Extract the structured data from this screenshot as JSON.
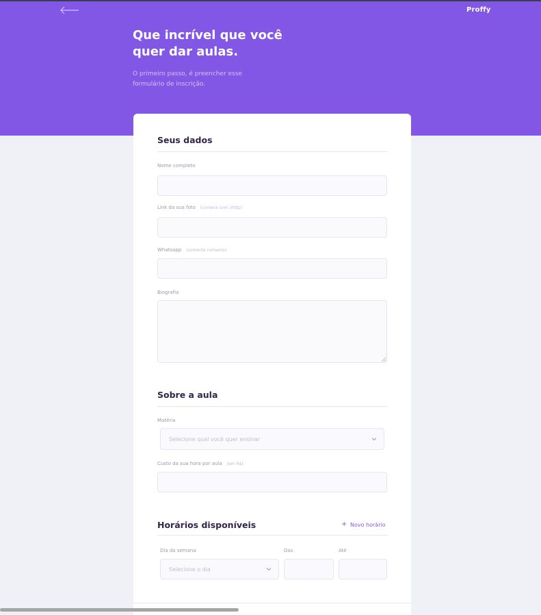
{
  "header": {
    "logo": "Proffy",
    "title": "Que incrível que você quer dar aulas.",
    "subtitle": "O primeiro passo, é preencher esse formulário de inscrição.",
    "back_icon": "arrow-left-icon"
  },
  "colors": {
    "primary": "#8257e5",
    "background": "#f0f0f7",
    "card": "#ffffff",
    "title_text": "#32264d",
    "label_text": "#9c98a6"
  },
  "sections": {
    "personal": {
      "title": "Seus dados",
      "name_label": "Nome completo",
      "avatar_label": "Link da sua foto",
      "avatar_hint": "(comece com //http)",
      "whatsapp_label": "Whatsapp",
      "whatsapp_hint": "(somente números)",
      "bio_label": "Biografia"
    },
    "class": {
      "title": "Sobre a aula",
      "subject_label": "Matéria",
      "subject_placeholder": "Selecione qual você quer ensinar",
      "cost_label": "Custo da sua hora por aula",
      "cost_hint": "(em R$)"
    },
    "schedule": {
      "title": "Horários disponíveis",
      "add_plus": "+",
      "add_label": "Novo horário",
      "weekday_label": "Dia da semana",
      "weekday_placeholder": "Selecione o dia",
      "from_label": "Das",
      "to_label": "Até"
    }
  }
}
